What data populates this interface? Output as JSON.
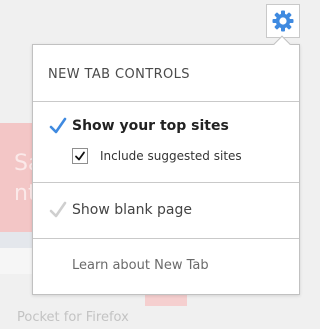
{
  "background": {
    "tile_text_line1": "Sa",
    "tile_text_line2": "nte",
    "caption": "Pocket for Firefox"
  },
  "gear_button": {
    "icon": "gear-icon",
    "color": "#3f8ae0"
  },
  "panel": {
    "title": "NEW TAB CONTROLS",
    "show_top_sites": {
      "label": "Show your top sites",
      "checked": true,
      "check_color": "#3f8ae0"
    },
    "include_suggested": {
      "label": "Include suggested sites",
      "checked": true
    },
    "show_blank": {
      "label": "Show blank page",
      "checked": false,
      "check_color": "#cfcfcf"
    },
    "learn_more": "Learn about New Tab"
  }
}
